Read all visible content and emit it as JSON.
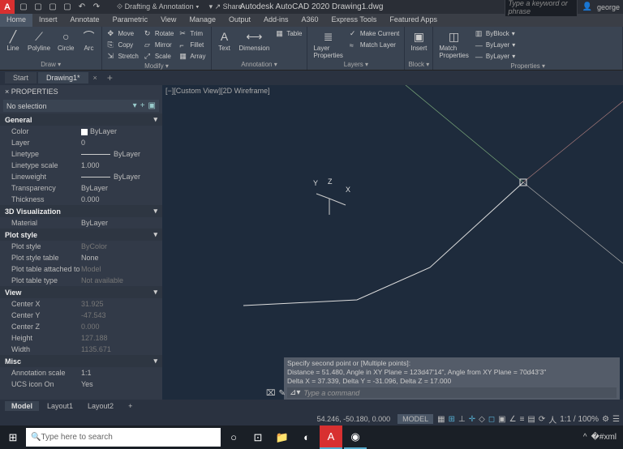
{
  "titlebar": {
    "logo": "A",
    "workspace": "Drafting & Annotation",
    "share": "Share",
    "app_title": "Autodesk AutoCAD 2020   Drawing1.dwg",
    "search_placeholder": "Type a keyword or phrase",
    "user": "george"
  },
  "menu": [
    "Home",
    "Insert",
    "Annotate",
    "Parametric",
    "View",
    "Manage",
    "Output",
    "Add-ins",
    "A360",
    "Express Tools",
    "Featured Apps"
  ],
  "ribbon": {
    "draw": {
      "title": "Draw ▾",
      "line": "Line",
      "polyline": "Polyline",
      "circle": "Circle",
      "arc": "Arc"
    },
    "modify": {
      "title": "Modify ▾",
      "move": "Move",
      "copy": "Copy",
      "stretch": "Stretch",
      "rotate": "Rotate",
      "mirror": "Mirror",
      "scale": "Scale",
      "trim": "Trim",
      "fillet": "Fillet",
      "array": "Array"
    },
    "annotation": {
      "title": "Annotation ▾",
      "text": "Text",
      "dimension": "Dimension",
      "table": "Table"
    },
    "layers": {
      "title": "Layers ▾",
      "props": "Layer\nProperties",
      "make_current": "Make Current",
      "match": "Match Layer"
    },
    "block": {
      "title": "Block ▾",
      "insert": "Insert"
    },
    "properties": {
      "title": "Properties ▾",
      "match": "Match\nProperties",
      "byblock": "ByBlock",
      "bylayer1": "ByLayer",
      "bylayer2": "ByLayer"
    }
  },
  "doctabs": {
    "start": "Start",
    "drawing": "Drawing1*"
  },
  "props": {
    "title": "PROPERTIES",
    "selector": "No selection",
    "general": {
      "heading": "General",
      "rows": [
        {
          "k": "Color",
          "v": "ByLayer",
          "swatch": true
        },
        {
          "k": "Layer",
          "v": "0"
        },
        {
          "k": "Linetype",
          "v": "ByLayer",
          "line": true
        },
        {
          "k": "Linetype scale",
          "v": "1.000"
        },
        {
          "k": "Lineweight",
          "v": "ByLayer",
          "line": true
        },
        {
          "k": "Transparency",
          "v": "ByLayer"
        },
        {
          "k": "Thickness",
          "v": "0.000"
        }
      ]
    },
    "viz": {
      "heading": "3D Visualization",
      "rows": [
        {
          "k": "Material",
          "v": "ByLayer"
        }
      ]
    },
    "plot": {
      "heading": "Plot style",
      "rows": [
        {
          "k": "Plot style",
          "v": "ByColor",
          "dim": true
        },
        {
          "k": "Plot style table",
          "v": "None"
        },
        {
          "k": "Plot table attached to",
          "v": "Model",
          "dim": true
        },
        {
          "k": "Plot table type",
          "v": "Not available",
          "dim": true
        }
      ]
    },
    "view": {
      "heading": "View",
      "rows": [
        {
          "k": "Center X",
          "v": "31.925",
          "dim": true
        },
        {
          "k": "Center Y",
          "v": "-47.543",
          "dim": true
        },
        {
          "k": "Center Z",
          "v": "0.000",
          "dim": true
        },
        {
          "k": "Height",
          "v": "127.188",
          "dim": true
        },
        {
          "k": "Width",
          "v": "1135.671",
          "dim": true
        }
      ]
    },
    "misc": {
      "heading": "Misc",
      "rows": [
        {
          "k": "Annotation scale",
          "v": "1:1"
        },
        {
          "k": "UCS icon On",
          "v": "Yes"
        }
      ]
    }
  },
  "canvas": {
    "viewlabel": "[−][Custom View][2D Wireframe]",
    "ucs": {
      "x": "X",
      "y": "Y",
      "z": "Z"
    }
  },
  "cmd": {
    "hist1": "Specify second point or [Multiple points]:",
    "hist2": "Distance = 51.480,  Angle in XY Plane = 123d47'14\",  Angle from XY Plane = 70d43'3\"",
    "hist3": "Delta X = 37.339,  Delta Y = -31.096,  Delta Z = 17.000",
    "prompt": "Type a command"
  },
  "modeltabs": [
    "Model",
    "Layout1",
    "Layout2"
  ],
  "status": {
    "coords": "54.246, -50.180, 0.000",
    "model": "MODEL",
    "scale": "1:1 / 100%"
  },
  "taskbar": {
    "search": "Type here to search"
  }
}
